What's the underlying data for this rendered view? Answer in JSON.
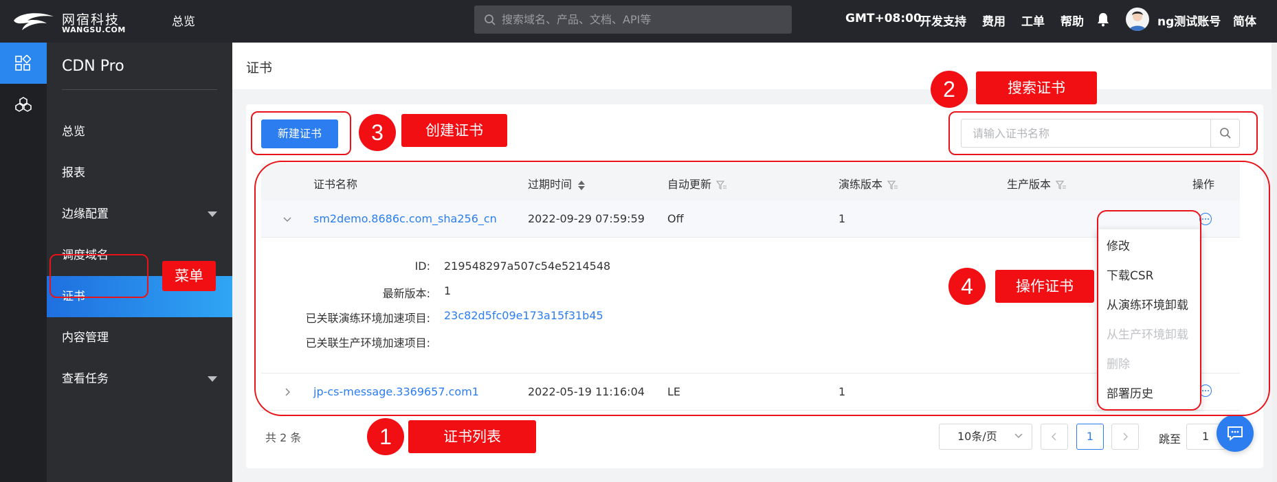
{
  "topbar": {
    "logo_cn": "网宿科技",
    "logo_en": "WANGSU.COM",
    "overview": "总览",
    "search_placeholder": "搜索域名、产品、文档、API等",
    "timezone": "GMT+08:00",
    "dev_support": "开发支持",
    "billing": "费用",
    "tickets": "工单",
    "help": "帮助",
    "user": "ng测试账号",
    "language": "简体"
  },
  "sidebar": {
    "title": "CDN Pro",
    "items": [
      {
        "label": "总览"
      },
      {
        "label": "报表"
      },
      {
        "label": "边缘配置"
      },
      {
        "label": "调度域名"
      },
      {
        "label": "证书"
      },
      {
        "label": "内容管理"
      },
      {
        "label": "查看任务"
      }
    ]
  },
  "page": {
    "title": "证书",
    "new_button": "新建证书",
    "search_placeholder": "请输入证书名称"
  },
  "table": {
    "headers": [
      "证书名称",
      "过期时间",
      "自动更新",
      "演练版本",
      "生产版本",
      "操作"
    ],
    "rows": [
      {
        "name": "sm2demo.8686c.com_sha256_cn",
        "expire": "2022-09-29 07:59:59",
        "auto_renew": "Off",
        "staging": "1",
        "production": ""
      },
      {
        "name": "jp-cs-message.3369657.com1",
        "expire": "2022-05-19 11:16:04",
        "auto_renew": "LE",
        "staging": "1",
        "production": ""
      }
    ],
    "detail": {
      "id_label": "ID:",
      "id_value": "219548297a507c54e5214548",
      "latest_label": "最新版本:",
      "latest_value": "1",
      "staging_proj_label": "已关联演练环境加速项目:",
      "staging_proj_value": "23c82d5fc09e173a15f31b45",
      "prod_proj_label": "已关联生产环境加速项目:"
    }
  },
  "actions_menu": [
    "修改",
    "下载CSR",
    "从演练环境卸载",
    "从生产环境卸载",
    "删除",
    "部署历史"
  ],
  "pagination": {
    "total": "共 2 条",
    "page_size": "10条/页",
    "current": "1",
    "jump_label": "跳至",
    "jump_value": "1"
  },
  "annotations": {
    "n1": "1",
    "label1": "证书列表",
    "n2": "2",
    "label2": "搜索证书",
    "n3": "3",
    "label3": "创建证书",
    "n4": "4",
    "label4": "操作证书",
    "menu_label": "菜单"
  },
  "colors": {
    "accent": "#2b7df0",
    "annotation": "#f20f14",
    "topbar": "#24262b",
    "sidebar": "#2b2d31"
  }
}
